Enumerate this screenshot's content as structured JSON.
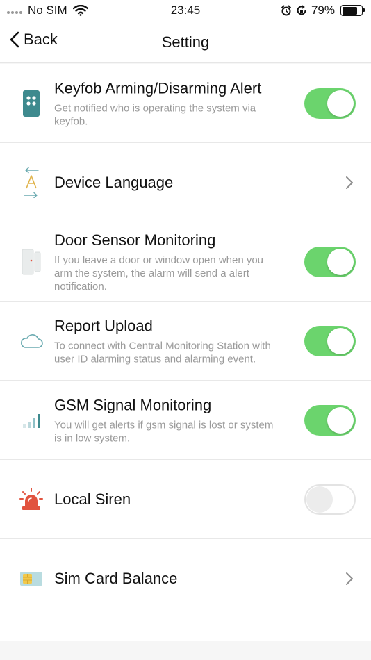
{
  "status_bar": {
    "carrier": "No SIM",
    "time": "23:45",
    "battery": "79%",
    "battery_level": 0.79,
    "icons": [
      "signal-dots-icon",
      "wifi-icon",
      "alarm-icon",
      "orientation-lock-icon",
      "battery-icon"
    ]
  },
  "nav": {
    "back_label": "Back",
    "title": "Setting"
  },
  "settings": [
    {
      "title": "Keyfob Arming/Disarming Alert",
      "desc": "Get notified who is operating the system via keyfob.",
      "control": "toggle",
      "on": true,
      "icon": "keyfob-icon"
    },
    {
      "title": "Device Language",
      "control": "chevron",
      "icon": "language-icon"
    },
    {
      "title": "Door Sensor Monitoring",
      "desc": "If you leave a door or window open when you arm the system, the alarm will send a alert notification.",
      "control": "toggle",
      "on": true,
      "icon": "door-sensor-icon"
    },
    {
      "title": "Report Upload",
      "desc": "To connect with Central Monitoring Station with user ID alarming status and alarming event.",
      "control": "toggle",
      "on": true,
      "icon": "cloud-icon"
    },
    {
      "title": "GSM Signal Monitoring",
      "desc": "You will get alerts if gsm signal is lost or system is in low system.",
      "control": "toggle",
      "on": true,
      "icon": "signal-bars-icon"
    },
    {
      "title": "Local Siren",
      "control": "toggle",
      "on": false,
      "icon": "siren-icon"
    },
    {
      "title": "Sim Card Balance",
      "control": "chevron",
      "icon": "sim-card-icon"
    }
  ],
  "colors": {
    "toggle_on": "#6bd46d",
    "keyfob_icon": "#3e8a8e",
    "siren_icon": "#e1533f",
    "sim_icon": "#f2c94c",
    "cloud_icon": "#6aaab0"
  }
}
